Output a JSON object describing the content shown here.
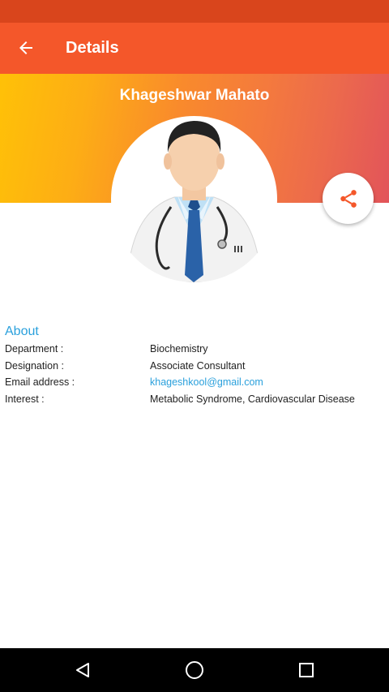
{
  "app_bar": {
    "title": "Details",
    "back_icon": "arrow-back-icon"
  },
  "profile": {
    "name": "Khageshwar Mahato",
    "avatar_icon": "doctor-avatar-icon",
    "share_icon": "share-icon"
  },
  "about": {
    "title": "About",
    "rows": [
      {
        "label": "Department :",
        "value": "Biochemistry"
      },
      {
        "label": "Designation :",
        "value": "Associate Consultant"
      },
      {
        "label": "Email address :",
        "value": "khageshkool@gmail.com"
      },
      {
        "label": "Interest :",
        "value": "Metabolic Syndrome, Cardiovascular Disease"
      }
    ]
  },
  "nav": {
    "back_icon": "nav-back-icon",
    "home_icon": "nav-home-icon",
    "recents_icon": "nav-recents-icon"
  },
  "colors": {
    "status_bar": "#d9451c",
    "app_bar": "#f4572a",
    "accent": "#2aa0dc"
  }
}
